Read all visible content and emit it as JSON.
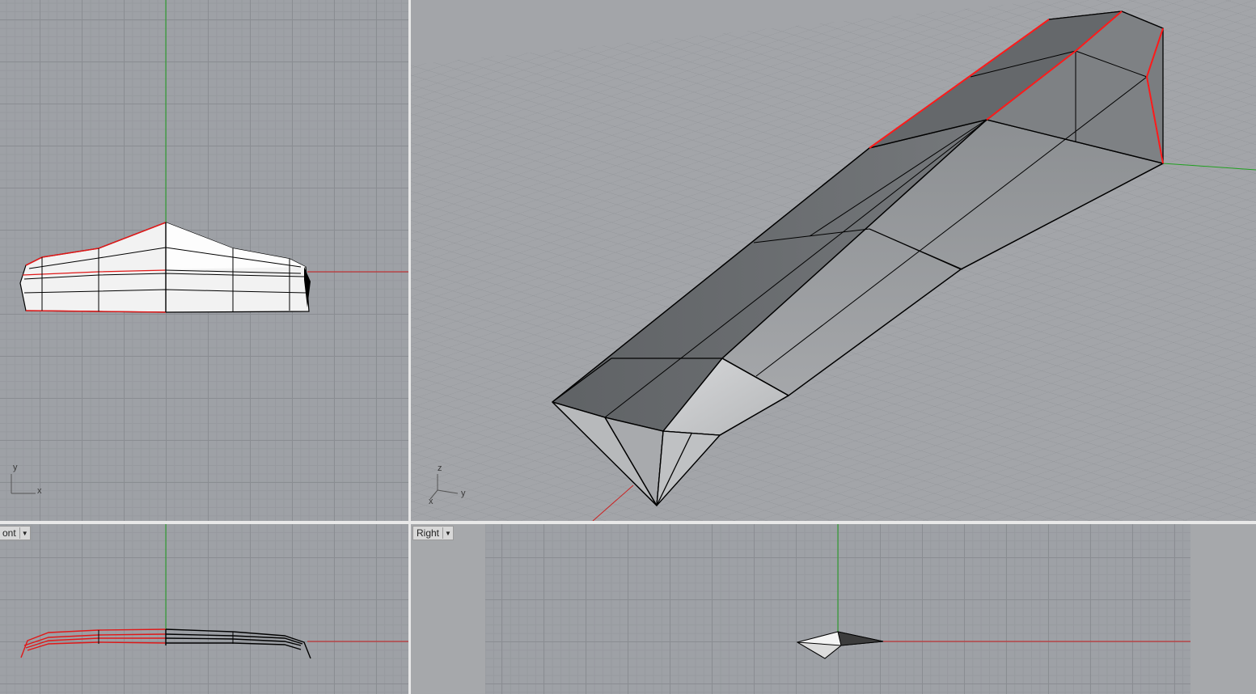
{
  "viewports": {
    "top": {
      "axis_x": "x",
      "axis_y": "y"
    },
    "perspective": {
      "axis_x": "x",
      "axis_y": "y",
      "axis_z": "z"
    },
    "front": {
      "title": "ont"
    },
    "right": {
      "title": "Right"
    }
  },
  "colors": {
    "x_axis": "#cc2020",
    "y_axis": "#20a020",
    "edge": "#000000",
    "selected_edge": "#ff1a1a"
  },
  "icons": {
    "dropdown": "chevron-down-icon"
  }
}
